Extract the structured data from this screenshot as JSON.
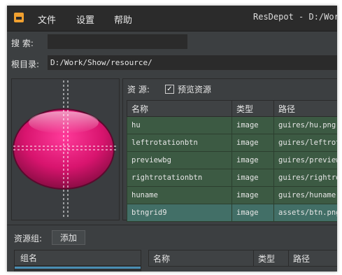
{
  "menubar": {
    "items": [
      "文件",
      "设置",
      "帮助"
    ],
    "window_title": "ResDepot - D:/Work/Show/resource/"
  },
  "search": {
    "label": "搜  索:",
    "value": ""
  },
  "root": {
    "label": "根目录:",
    "path": "D:/Work/Show/resource/"
  },
  "resources": {
    "label": "资  源:",
    "preview_checkbox_label": "预览资源",
    "preview_checked": true,
    "columns": [
      "名称",
      "类型",
      "路径"
    ],
    "rows": [
      {
        "name": "hu",
        "type": "image",
        "path": "guires/hu.png"
      },
      {
        "name": "leftrotationbtn",
        "type": "image",
        "path": "guires/leftrotationbtn.png"
      },
      {
        "name": "previewbg",
        "type": "image",
        "path": "guires/previewbg.png"
      },
      {
        "name": "rightrotationbtn",
        "type": "image",
        "path": "guires/rightrotationbtn.png"
      },
      {
        "name": "huname",
        "type": "image",
        "path": "guires/huname.png"
      },
      {
        "name": "btngrid9",
        "type": "image",
        "path": "assets/btn.png"
      }
    ],
    "selected_row": 5
  },
  "groups": {
    "label": "资源组:",
    "add_button": "添加",
    "list_header": "组名",
    "member_columns": [
      "名称",
      "类型",
      "路径"
    ]
  },
  "colors": {
    "background": "#3c3f41",
    "row": "#3c5a43",
    "selected_row": "#426f67",
    "preview_fill": "#d8146e"
  }
}
